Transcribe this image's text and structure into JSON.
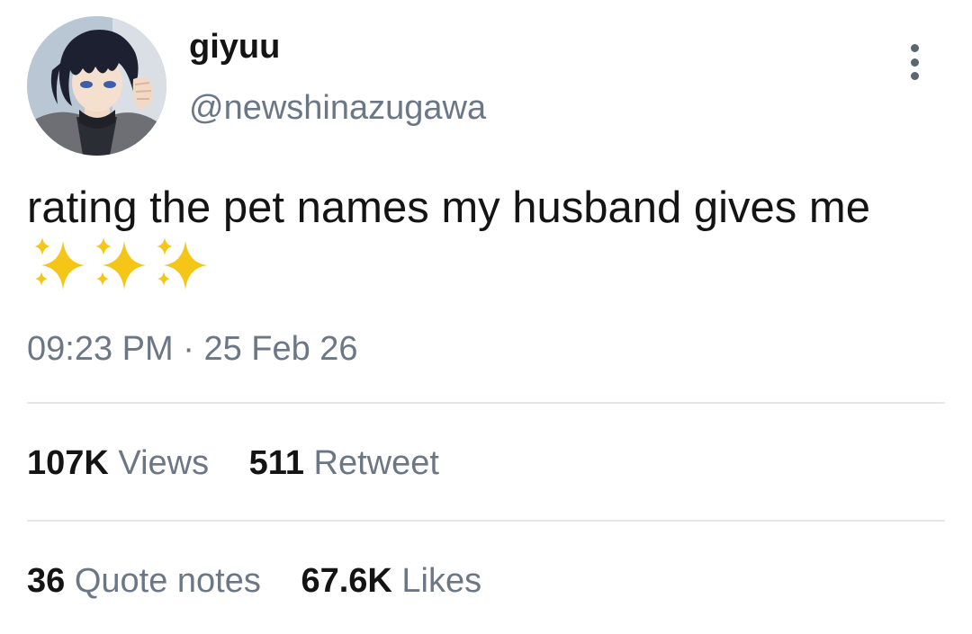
{
  "author": {
    "display_name": "giyuu",
    "handle": "@newshinazugawa",
    "avatar": "anime-character-avatar"
  },
  "tweet": {
    "text": "rating the pet names my husband gives me",
    "emoji": "✨✨✨",
    "time": "09:23 PM",
    "separator": "·",
    "date": "25 Feb 26"
  },
  "stats": {
    "views": {
      "count": "107K",
      "label": "Views"
    },
    "retweets": {
      "count": "511",
      "label": "Retweet"
    },
    "quotes": {
      "count": "36",
      "label": "Quote notes"
    },
    "likes": {
      "count": "67.6K",
      "label": "Likes"
    }
  },
  "icons": {
    "more": "more-vertical-icon",
    "sparkles": "sparkles-icon"
  },
  "colors": {
    "text_primary": "#141414",
    "text_secondary": "#6b7785",
    "divider": "#e3e7eb",
    "sparkle": "#f5c518"
  }
}
